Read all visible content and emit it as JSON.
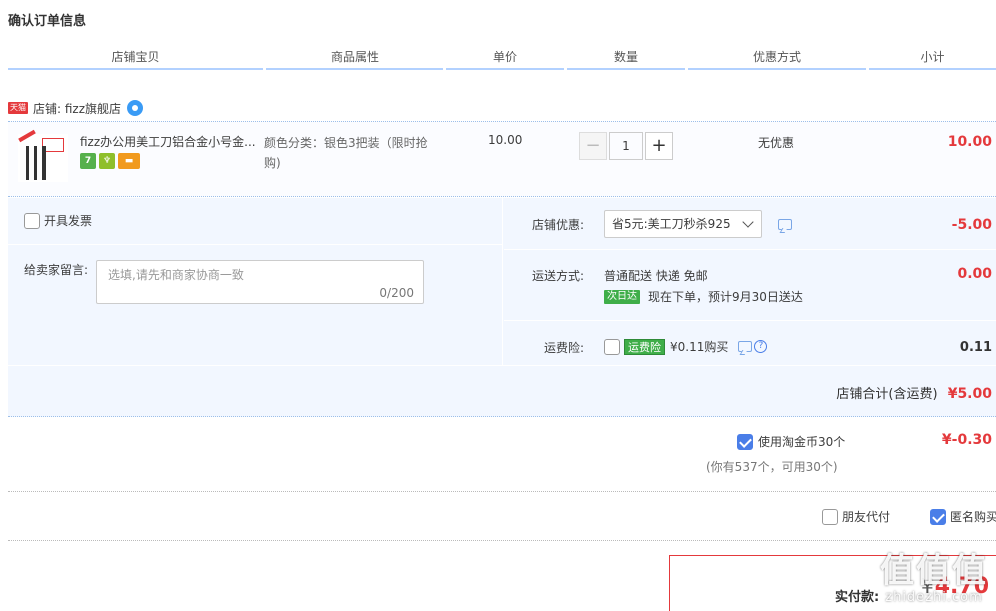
{
  "page": {
    "title": "确认订单信息"
  },
  "columns": [
    "店铺宝贝",
    "商品属性",
    "单价",
    "数量",
    "优惠方式",
    "小计"
  ],
  "shop": {
    "tag": "天猫",
    "name": "店铺: fizz旗舰店"
  },
  "item": {
    "title": "fizz办公用美工刀铝合金小号金...",
    "attribute": "颜色分类：银色3把装（限时抢购)",
    "unit_price": "10.00",
    "quantity": "1",
    "minus": "−",
    "plus": "+",
    "discount": "无优惠",
    "subtotal": "10.00",
    "badges": [
      "7",
      "",
      ""
    ]
  },
  "invoice": {
    "label": "开具发票",
    "checked": false
  },
  "message": {
    "label": "给卖家留言:",
    "placeholder": "选填,请先和商家协商一致",
    "count": "0/200"
  },
  "shop_discount": {
    "label": "店铺优惠:",
    "selected": "省5元:美工刀秒杀925",
    "amount": "-5.00"
  },
  "shipping": {
    "label": "运送方式:",
    "method": "普通配送 快递 免邮",
    "nextday_badge": "次日达",
    "eta": "现在下单，预计9月30日送达",
    "amount": "0.00"
  },
  "insurance": {
    "label": "运费险:",
    "badge": "运费险",
    "text": "¥0.11购买",
    "help": "?",
    "amount": "0.11",
    "checked": false
  },
  "shop_total": {
    "label": "店铺合计(含运费)",
    "value": "¥5.00"
  },
  "coins": {
    "label": "使用淘金币30个",
    "sub": "(你有537个，可用30个)",
    "amount": "¥-0.30",
    "checked": true
  },
  "friend_pay": {
    "label": "朋友代付",
    "checked": false
  },
  "anonymous": {
    "label": "匿名购买",
    "checked": true
  },
  "total": {
    "label": "实付款:",
    "currency": "¥",
    "value": "4.70"
  },
  "watermark": {
    "big": "值值值",
    "small": "zhidezhi.com"
  },
  "colors": {
    "accent_red": "#e4393c",
    "header_line": "#b2d1ff",
    "panel_bg": "#f2f7ff",
    "checkbox_blue": "#4a7ee8",
    "green_badge": "#3fae49"
  }
}
